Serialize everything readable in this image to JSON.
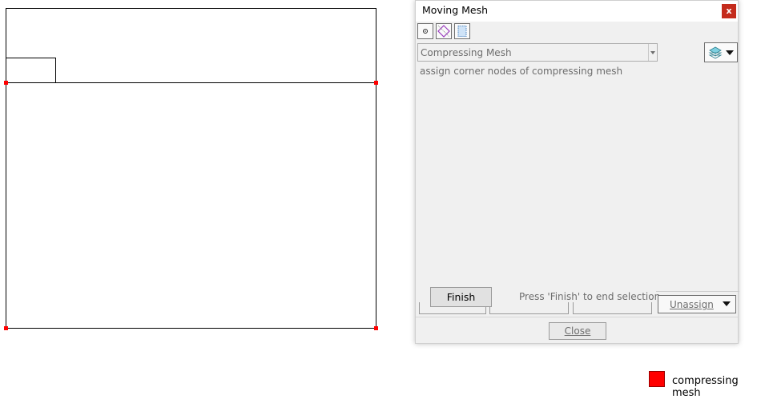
{
  "dialog": {
    "title": "Moving Mesh",
    "close_glyph": "x",
    "toolbar": [
      {
        "icon": "select-node-icon"
      },
      {
        "icon": "select-polygon-icon"
      },
      {
        "icon": "select-area-icon"
      }
    ],
    "mesh_combo": {
      "selected": "Compressing Mesh"
    },
    "layer_button": {
      "icon": "layers-icon"
    },
    "hint": "assign corner nodes of compressing mesh",
    "finish_label": "Finish",
    "finish_hint": "Press 'Finish' to end selection",
    "unassign_label": "Unassign",
    "close_label": "Close"
  },
  "legend": {
    "color": "#ff0000",
    "label": "compressing mesh"
  },
  "colors": {
    "marker": "#ff0000",
    "geometry_line": "#000000",
    "dialog_bg": "#f0f0f0",
    "close_red": "#c42b1c"
  }
}
